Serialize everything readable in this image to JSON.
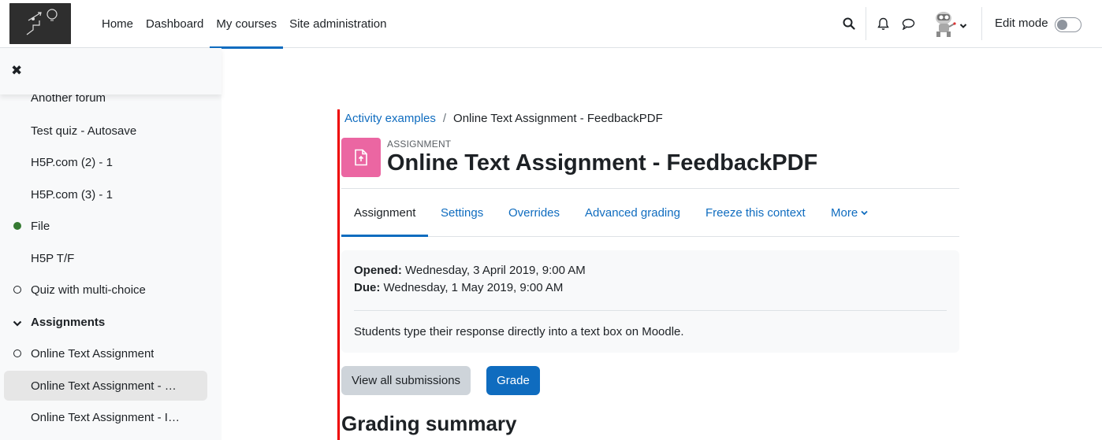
{
  "navbar": {
    "items": [
      {
        "label": "Home",
        "active": false
      },
      {
        "label": "Dashboard",
        "active": false
      },
      {
        "label": "My courses",
        "active": true
      },
      {
        "label": "Site administration",
        "active": false
      }
    ],
    "edit_mode_label": "Edit mode",
    "edit_mode_on": false,
    "icons": [
      "search-icon",
      "bell-icon",
      "chat-icon",
      "user-avatar",
      "chevron-down-icon"
    ]
  },
  "drawer": {
    "close_icon": "close-icon",
    "items": [
      {
        "label": "Another forum",
        "status": "none"
      },
      {
        "label": "Test quiz - Autosave",
        "status": "none"
      },
      {
        "label": "H5P.com (2) - 1",
        "status": "none"
      },
      {
        "label": "H5P.com (3) - 1",
        "status": "none"
      },
      {
        "label": "File",
        "status": "done"
      },
      {
        "label": "H5P T/F",
        "status": "none"
      },
      {
        "label": "Quiz with multi-choice",
        "status": "todo"
      },
      {
        "label": "Assignments",
        "status": "section"
      },
      {
        "label": "Online Text Assignment",
        "status": "todo"
      },
      {
        "label": "Online Text Assignment - …",
        "status": "active"
      },
      {
        "label": "Online Text Assignment - I…",
        "status": "none"
      }
    ]
  },
  "breadcrumb": {
    "parent": "Activity examples",
    "separator": "/",
    "current": "Online Text Assignment - FeedbackPDF"
  },
  "activity": {
    "type": "ASSIGNMENT",
    "title": "Online Text Assignment - FeedbackPDF",
    "icon_color": "#eb66a2"
  },
  "tabs": [
    {
      "label": "Assignment",
      "active": true
    },
    {
      "label": "Settings",
      "active": false
    },
    {
      "label": "Overrides",
      "active": false
    },
    {
      "label": "Advanced grading",
      "active": false
    },
    {
      "label": "Freeze this context",
      "active": false
    },
    {
      "label": "More",
      "active": false
    }
  ],
  "dates": {
    "opened_label": "Opened:",
    "opened_value": "Wednesday, 3 April 2019, 9:00 AM",
    "due_label": "Due:",
    "due_value": "Wednesday, 1 May 2019, 9:00 AM"
  },
  "intro": "Students type their response directly into a text box on Moodle.",
  "buttons": {
    "view_all": "View all submissions",
    "grade": "Grade"
  },
  "grading_summary_heading": "Grading summary",
  "colors": {
    "brand": "#0f6cbf",
    "accent_line": "#e00000"
  }
}
